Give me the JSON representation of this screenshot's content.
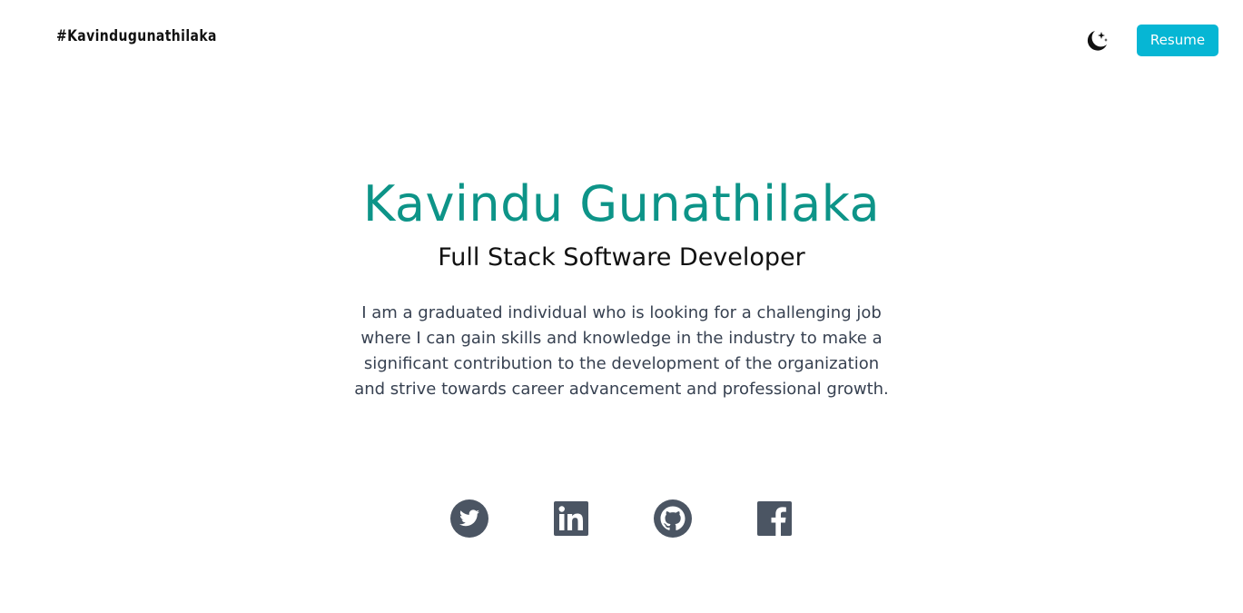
{
  "header": {
    "brand": "#Kavindugunathilaka",
    "theme_toggle_icon": "moon-stars-icon",
    "resume_label": "Resume"
  },
  "hero": {
    "name": "Kavindu Gunathilaka",
    "role": "Full Stack Software Developer",
    "description": "I am a graduated individual who is looking for a challenging job where I can gain skills and knowledge in the industry to make a significant contribution to the development of the organization and strive towards career advancement and professional growth."
  },
  "socials": [
    {
      "icon": "twitter-icon"
    },
    {
      "icon": "linkedin-icon"
    },
    {
      "icon": "github-icon"
    },
    {
      "icon": "facebook-icon"
    }
  ],
  "colors": {
    "accent": "#0d9488",
    "button": "#06b6d4",
    "icon": "#4b5563",
    "text": "#374151"
  }
}
